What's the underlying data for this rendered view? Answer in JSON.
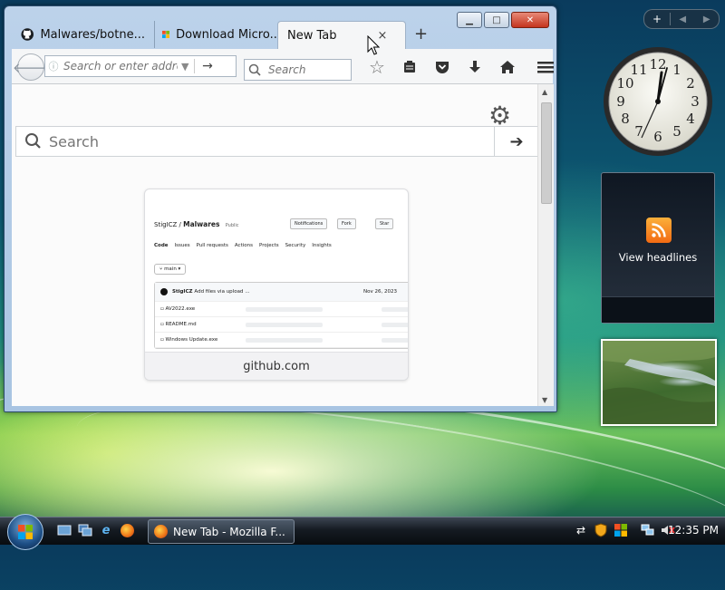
{
  "browser": {
    "tabs": [
      {
        "label": "Malwares/botne...",
        "icon": "github-icon",
        "active": false
      },
      {
        "label": "Download Micro...",
        "icon": "microsoft-icon",
        "active": false
      },
      {
        "label": "New Tab",
        "icon": "",
        "active": true
      }
    ],
    "close_tab": "×",
    "new_tab": "+",
    "window_controls": {
      "minimize": "▁",
      "maximize": "□",
      "close": "✕"
    },
    "url_placeholder": "Search or enter address",
    "search_placeholder": "Search"
  },
  "newtab": {
    "search_placeholder": "Search",
    "tile": {
      "label": "github.com",
      "repo_owner": "StigICZ",
      "repo_name": "Malwares",
      "visibility": "Public",
      "buttons": [
        "Notifications",
        "Fork",
        "Star"
      ],
      "tabs": [
        "Code",
        "Issues",
        "Pull requests",
        "Actions",
        "Projects",
        "Security",
        "Insights"
      ],
      "branch": "main",
      "commit_author": "StigICZ",
      "commit_msg": "Add files via upload",
      "commit_ellipsis": "...",
      "commit_date": "Nov 26, 2023",
      "files": [
        "AV2022.exe",
        "README.md",
        "Windows Update.exe"
      ]
    }
  },
  "sidebar": {
    "feed_label": "View headlines",
    "clock_time": "12:35"
  },
  "taskbar": {
    "active_window": "New Tab - Mozilla F...",
    "time": "12:35 PM"
  },
  "colors": {
    "accent": "#1d4f86",
    "rss": "#f26a12",
    "close": "#c4341e"
  }
}
